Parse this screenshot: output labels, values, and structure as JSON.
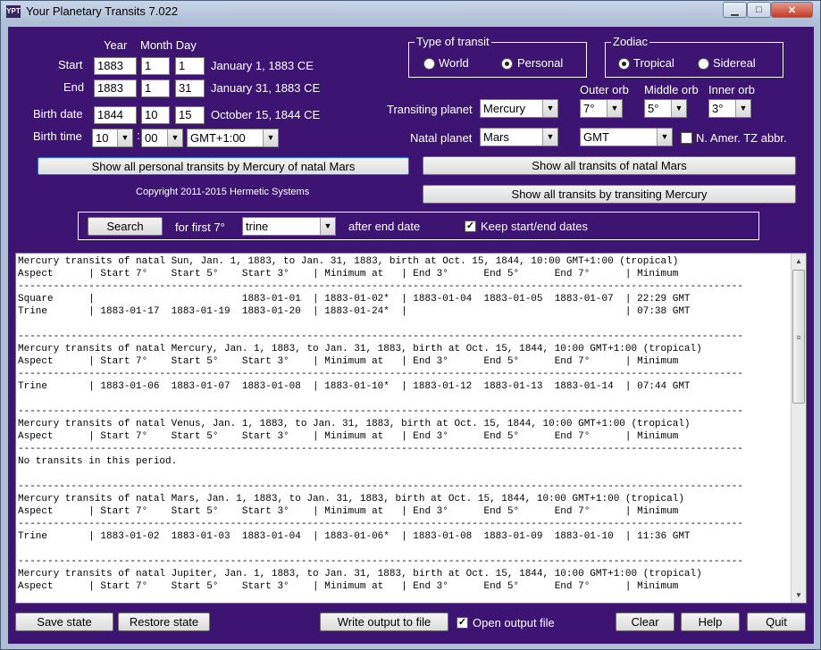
{
  "window": {
    "title": "Your Planetary Transits 7.022",
    "icon_text": "YPT",
    "min_glyph": "▁",
    "max_glyph": "□",
    "close_glyph": "✕"
  },
  "dates": {
    "year_header": "Year",
    "month_day_header": "Month Day",
    "start_label": "Start",
    "start_year": "1883",
    "start_month": "1",
    "start_day": "1",
    "start_text": "January 1, 1883 CE",
    "end_label": "End",
    "end_year": "1883",
    "end_month": "1",
    "end_day": "31",
    "end_text": "January 31, 1883 CE",
    "birth_date_label": "Birth date",
    "birth_year": "1844",
    "birth_month": "10",
    "birth_day": "15",
    "birth_text": "October 15, 1844 CE",
    "birth_time_label": "Birth time",
    "birth_hour": "10",
    "time_sep": ":",
    "birth_minute": "00",
    "birth_tz": "GMT+1:00"
  },
  "transit_type": {
    "title": "Type of transit",
    "world": "World",
    "personal": "Personal",
    "selected": "Personal"
  },
  "zodiac": {
    "title": "Zodiac",
    "tropical": "Tropical",
    "sidereal": "Sidereal",
    "selected": "Tropical"
  },
  "orbs": {
    "outer_label": "Outer orb",
    "outer_value": "7°",
    "middle_label": "Middle orb",
    "middle_value": "5°",
    "inner_label": "Inner orb",
    "inner_value": "3°"
  },
  "planets": {
    "transiting_label": "Transiting planet",
    "transiting_value": "Mercury",
    "natal_label": "Natal planet",
    "natal_value": "Mars",
    "tz_value": "GMT",
    "na_tz_label": "N. Amer. TZ abbr."
  },
  "buttons": {
    "show_personal": "Show all personal transits by Mercury of natal Mars",
    "show_natal": "Show all transits of natal Mars",
    "show_transiting": "Show all transits by transiting Mercury",
    "search": "Search",
    "save_state": "Save state",
    "restore_state": "Restore state",
    "write_output": "Write output to file",
    "clear": "Clear",
    "help": "Help",
    "quit": "Quit"
  },
  "copyright": "Copyright 2011-2015 Hermetic Systems",
  "search": {
    "for_first": "for first 7°",
    "aspect": "trine",
    "after": "after end date",
    "keep_label": "Keep start/end dates"
  },
  "open_output_label": "Open output file",
  "output_lines": [
    "Mercury transits of natal Sun, Jan. 1, 1883, to Jan. 31, 1883, birth at Oct. 15, 1844, 10:00 GMT+1:00 (tropical)",
    "Aspect      | Start 7°    Start 5°    Start 3°    | Minimum at   | End 3°      End 5°      End 7°      | Minimum",
    "---------------------------------------------------------------------------------------------------------------------------",
    "Square      |                         1883-01-01  | 1883-01-02*  | 1883-01-04  1883-01-05  1883-01-07  | 22:29 GMT",
    "Trine       | 1883-01-17  1883-01-19  1883-01-20  | 1883-01-24*  |                                     | 07:38 GMT",
    "",
    "---------------------------------------------------------------------------------------------------------------------------",
    "Mercury transits of natal Mercury, Jan. 1, 1883, to Jan. 31, 1883, birth at Oct. 15, 1844, 10:00 GMT+1:00 (tropical)",
    "Aspect      | Start 7°    Start 5°    Start 3°    | Minimum at   | End 3°      End 5°      End 7°      | Minimum",
    "---------------------------------------------------------------------------------------------------------------------------",
    "Trine       | 1883-01-06  1883-01-07  1883-01-08  | 1883-01-10*  | 1883-01-12  1883-01-13  1883-01-14  | 07:44 GMT",
    "",
    "---------------------------------------------------------------------------------------------------------------------------",
    "Mercury transits of natal Venus, Jan. 1, 1883, to Jan. 31, 1883, birth at Oct. 15, 1844, 10:00 GMT+1:00 (tropical)",
    "Aspect      | Start 7°    Start 5°    Start 3°    | Minimum at   | End 3°      End 5°      End 7°      | Minimum",
    "---------------------------------------------------------------------------------------------------------------------------",
    "No transits in this period.",
    "",
    "---------------------------------------------------------------------------------------------------------------------------",
    "Mercury transits of natal Mars, Jan. 1, 1883, to Jan. 31, 1883, birth at Oct. 15, 1844, 10:00 GMT+1:00 (tropical)",
    "Aspect      | Start 7°    Start 5°    Start 3°    | Minimum at   | End 3°      End 5°      End 7°      | Minimum",
    "---------------------------------------------------------------------------------------------------------------------------",
    "Trine       | 1883-01-02  1883-01-03  1883-01-04  | 1883-01-06*  | 1883-01-08  1883-01-09  1883-01-10  | 11:36 GMT",
    "",
    "---------------------------------------------------------------------------------------------------------------------------",
    "Mercury transits of natal Jupiter, Jan. 1, 1883, to Jan. 31, 1883, birth at Oct. 15, 1844, 10:00 GMT+1:00 (tropical)",
    "Aspect      | Start 7°    Start 5°    Start 3°    | Minimum at   | End 3°      End 5°      End 7°      | Minimum"
  ],
  "scroll_glyphs": {
    "up": "▲",
    "down": "▼",
    "grip": "≡"
  },
  "dropdown_glyph": "▼",
  "check_glyph": "✓"
}
